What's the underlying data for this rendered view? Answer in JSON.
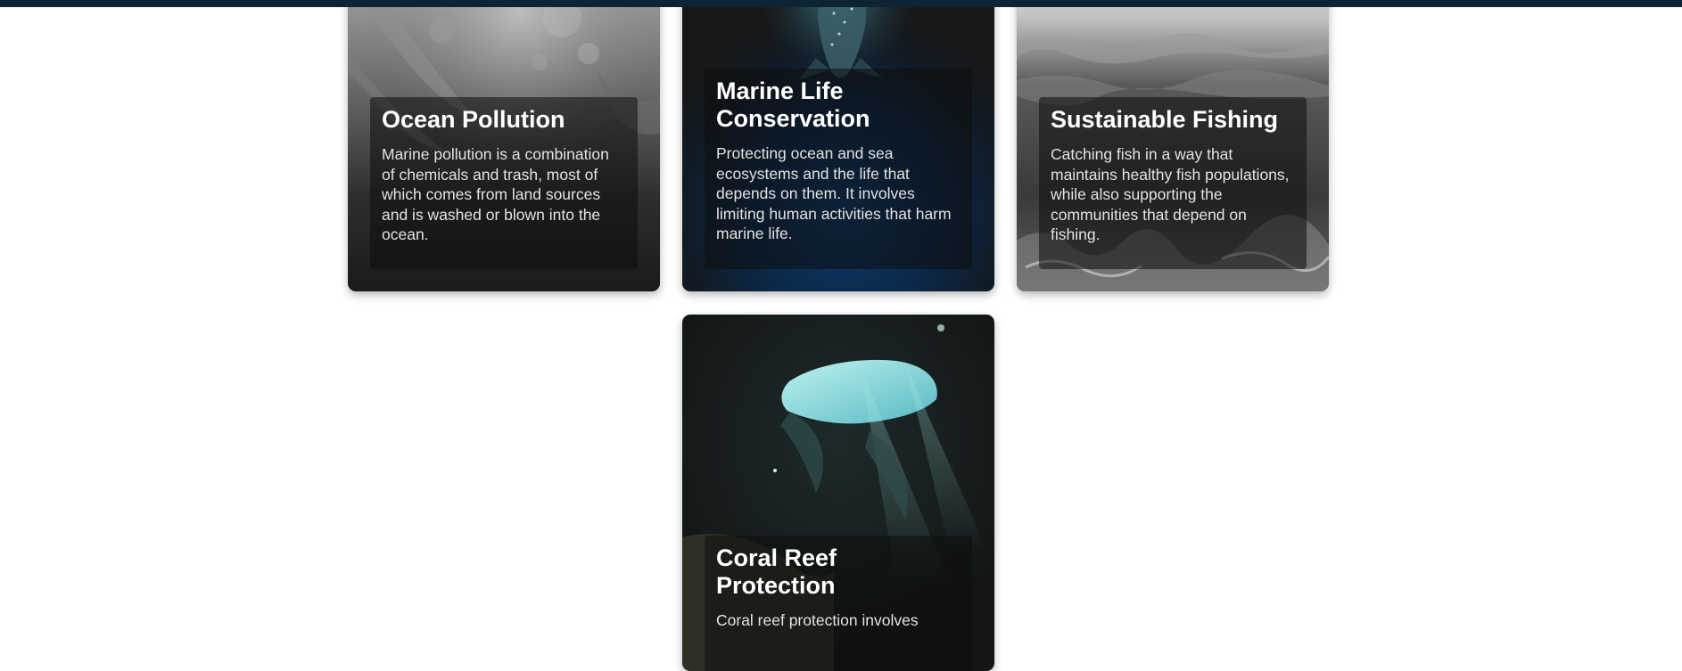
{
  "cards": [
    {
      "title": "Ocean Pollution",
      "description": "Marine pollution is a combination of chemicals and trash, most of which comes from land sources and is washed or blown into the ocean.",
      "image": "grayscale-seafloor-photo"
    },
    {
      "title": "Marine Life Conservation",
      "description": "Protecting ocean and sea ecosystems and the life that depends on them. It involves limiting human activities that harm marine life.",
      "image": "whale-shark-deep-blue-photo"
    },
    {
      "title": "Sustainable Fishing",
      "description": "Catching fish in a way that maintains healthy fish populations, while also supporting the communities that depend on fishing.",
      "image": "grayscale-ocean-waves-photo"
    },
    {
      "title": "Coral Reef Protection",
      "description": "Coral reef protection involves",
      "image": "underwater-cave-coral-photo"
    }
  ],
  "colors": {
    "topbar": "#0f2433",
    "card_dark": "#1c1c1c",
    "deep_blue": "#0b2d54",
    "cave_light": "#7fd6d8"
  }
}
